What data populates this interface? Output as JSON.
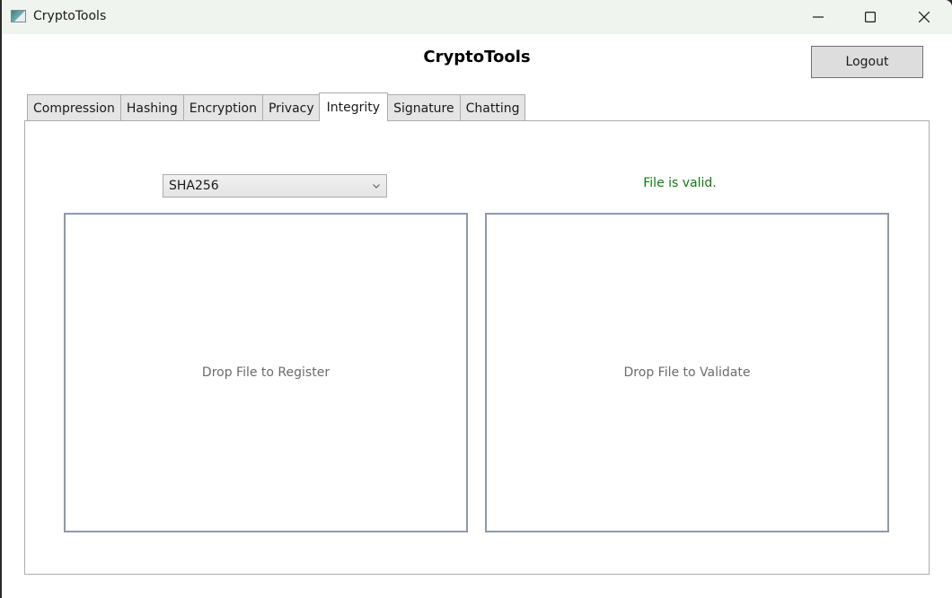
{
  "window": {
    "title": "CryptoTools",
    "controls": {
      "minimize": "minimize-icon",
      "maximize": "maximize-icon",
      "close": "close-icon"
    }
  },
  "header": {
    "title": "CryptoTools",
    "logout_label": "Logout"
  },
  "tabs": [
    {
      "label": "Compression",
      "active": false
    },
    {
      "label": "Hashing",
      "active": false
    },
    {
      "label": "Encryption",
      "active": false
    },
    {
      "label": "Privacy",
      "active": false
    },
    {
      "label": "Integrity",
      "active": true
    },
    {
      "label": "Signature",
      "active": false
    },
    {
      "label": "Chatting",
      "active": false
    }
  ],
  "integrity": {
    "algorithm": {
      "selected": "SHA256"
    },
    "status": {
      "text": "File is valid.",
      "color": "#117a11"
    },
    "register_zone": {
      "label": "Drop File to Register"
    },
    "validate_zone": {
      "label": "Drop File to Validate"
    }
  }
}
